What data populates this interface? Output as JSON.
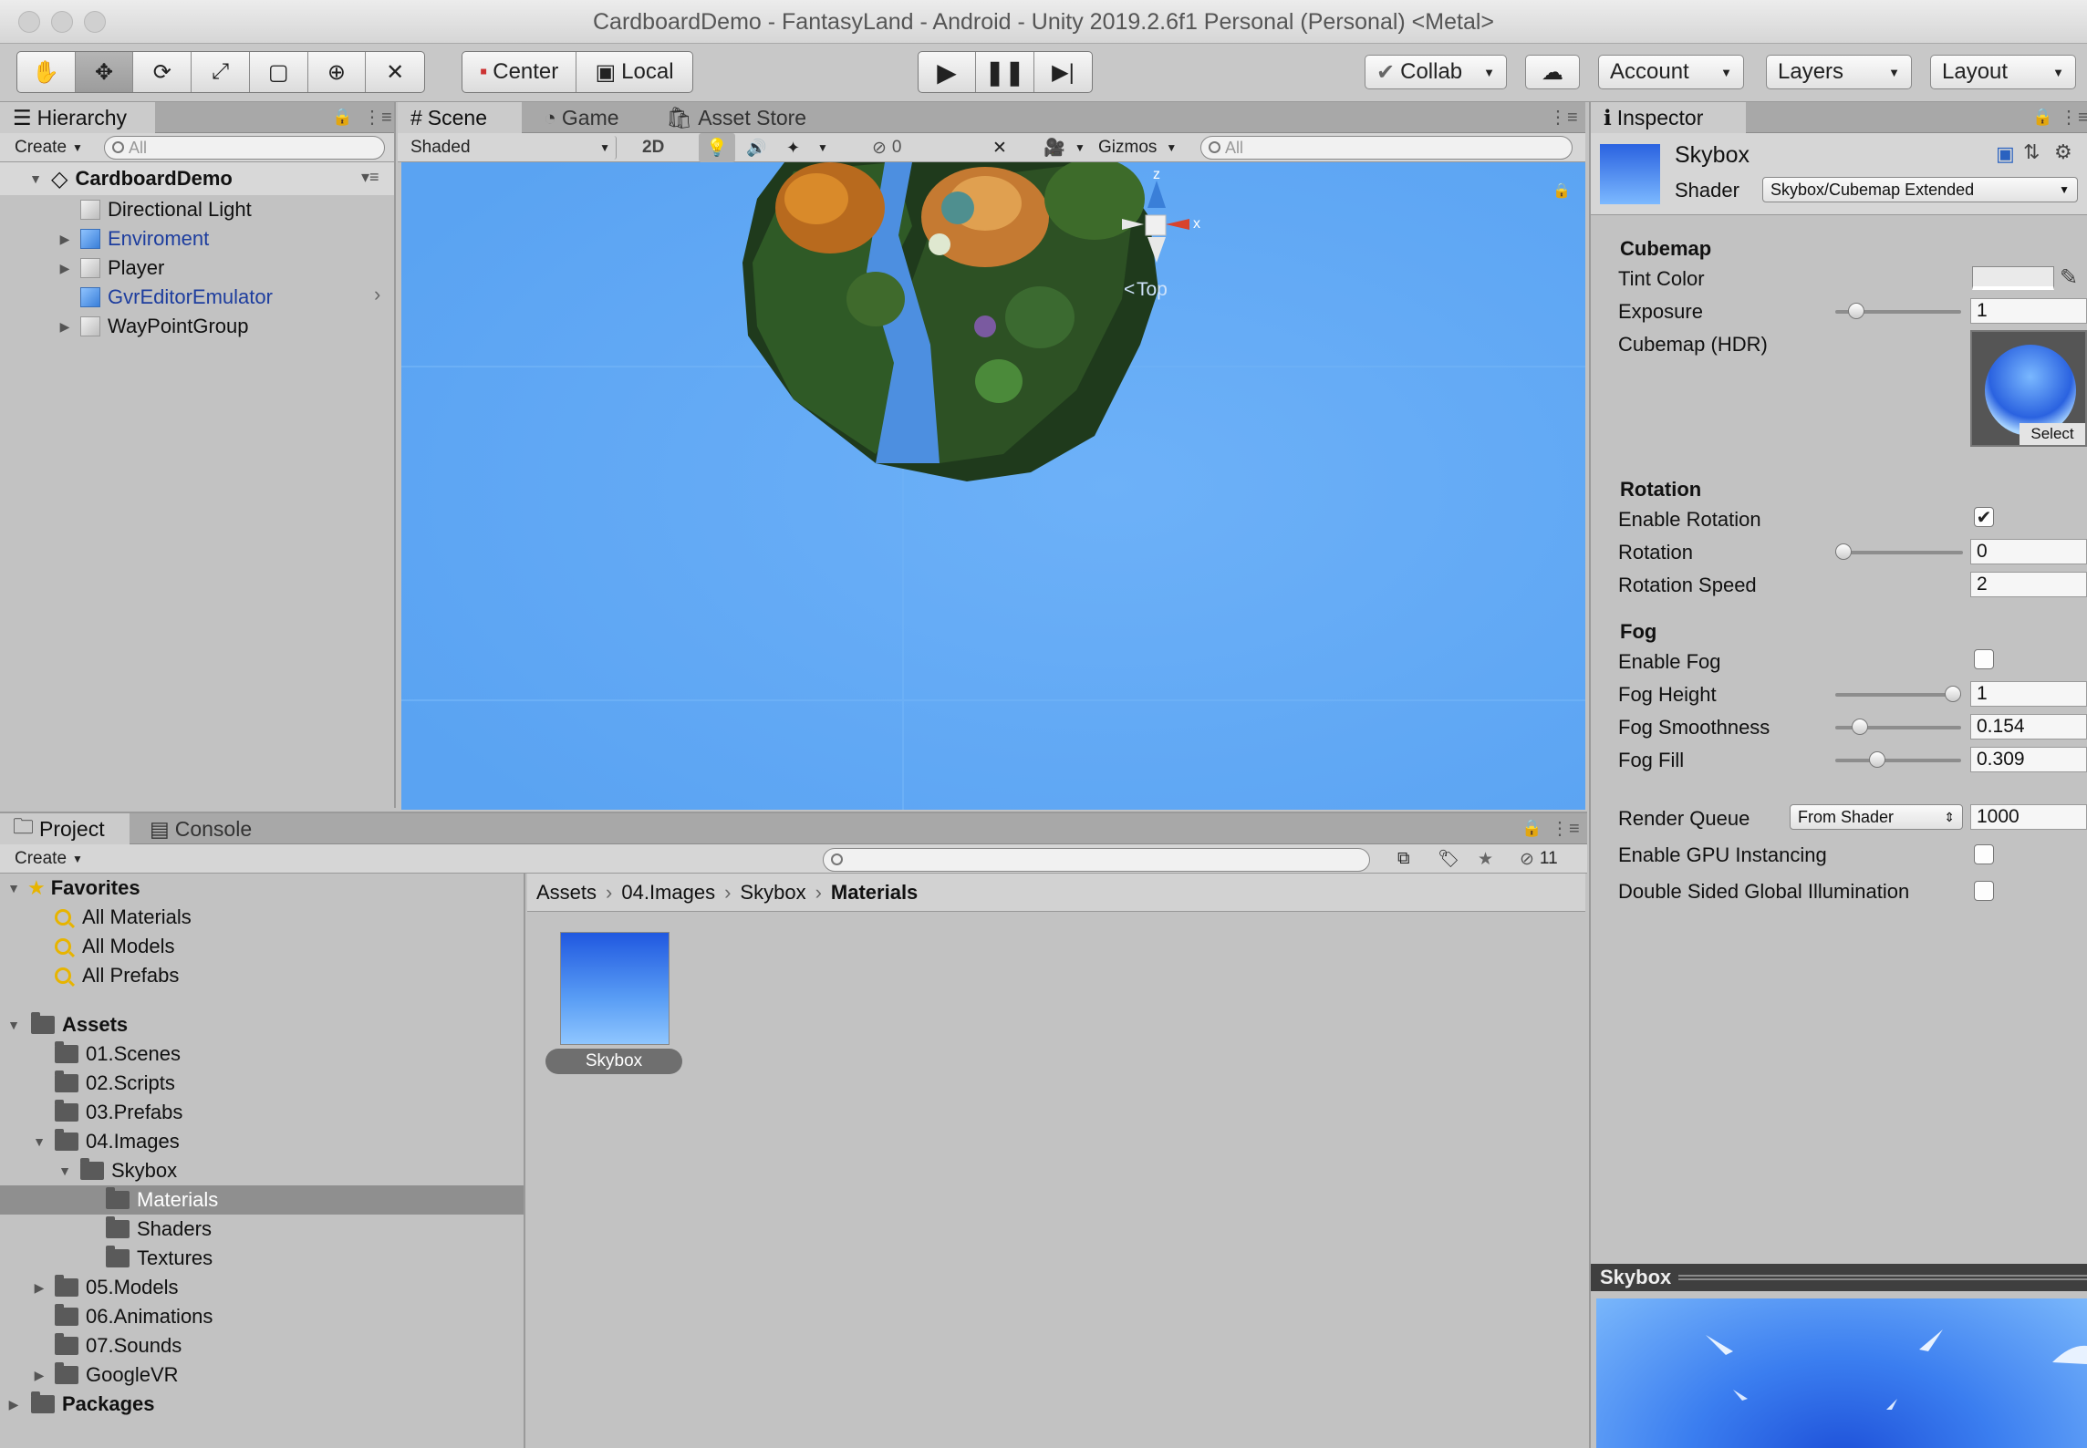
{
  "window": {
    "title": "CardboardDemo - FantasyLand - Android - Unity 2019.2.6f1 Personal (Personal) <Metal>"
  },
  "toolbar": {
    "pivot_mode": "Center",
    "pivot_rotation": "Local",
    "collab": "Collab",
    "account": "Account",
    "layers": "Layers",
    "layout": "Layout"
  },
  "hierarchy": {
    "tab": "Hierarchy",
    "create": "Create",
    "search_placeholder": "All",
    "scene": "CardboardDemo",
    "items": [
      {
        "label": "Directional Light"
      },
      {
        "label": "Enviroment"
      },
      {
        "label": "Player"
      },
      {
        "label": "GvrEditorEmulator"
      },
      {
        "label": "WayPointGroup"
      }
    ]
  },
  "scene_view": {
    "tabs": [
      "Scene",
      "Game",
      "Asset Store"
    ],
    "shading": "Shaded",
    "mode_2d": "2D",
    "hidden_count": "0",
    "gizmos": "Gizmos",
    "search_placeholder": "All",
    "gizmo_z": "z",
    "gizmo_x": "x",
    "view_label": "Top"
  },
  "project": {
    "tabs": [
      "Project",
      "Console"
    ],
    "create": "Create",
    "hidden_count": "11",
    "favorites": {
      "label": "Favorites",
      "items": [
        "All Materials",
        "All Models",
        "All Prefabs"
      ]
    },
    "assets": {
      "label": "Assets",
      "folders": [
        "01.Scenes",
        "02.Scripts",
        "03.Prefabs",
        "04.Images",
        "Skybox",
        "Materials",
        "Shaders",
        "Textures",
        "05.Models",
        "06.Animations",
        "07.Sounds",
        "GoogleVR"
      ]
    },
    "packages": "Packages",
    "breadcrumb": [
      "Assets",
      "04.Images",
      "Skybox",
      "Materials"
    ],
    "asset_name": "Skybox"
  },
  "inspector": {
    "tab": "Inspector",
    "name": "Skybox",
    "shader_label": "Shader",
    "shader_value": "Skybox/Cubemap Extended",
    "sections": {
      "cubemap": "Cubemap",
      "rotation": "Rotation",
      "fog": "Fog"
    },
    "props": {
      "tint_color": "Tint Color",
      "exposure": "Exposure",
      "exposure_value": "1",
      "cubemap_hdr": "Cubemap (HDR)",
      "select": "Select",
      "enable_rotation": "Enable Rotation",
      "rotation": "Rotation",
      "rotation_value": "0",
      "rotation_speed": "Rotation Speed",
      "rotation_speed_value": "2",
      "enable_fog": "Enable Fog",
      "fog_height": "Fog Height",
      "fog_height_value": "1",
      "fog_smoothness": "Fog Smoothness",
      "fog_smoothness_value": "0.154",
      "fog_fill": "Fog Fill",
      "fog_fill_value": "0.309",
      "render_queue": "Render Queue",
      "render_queue_mode": "From Shader",
      "render_queue_value": "1000",
      "gpu_instancing": "Enable GPU Instancing",
      "double_sided_gi": "Double Sided Global Illumination"
    },
    "slider_levels": {
      "exposure": 0.12,
      "rotation": 0.0,
      "fog_height": 1.0,
      "fog_smoothness": 0.154,
      "fog_fill": 0.309
    },
    "checkboxes": {
      "enable_rotation": true,
      "enable_fog": false,
      "gpu_instancing": false,
      "double_sided_gi": false
    },
    "preview_title": "Skybox"
  },
  "colors": {
    "sky": "#5fa8f5",
    "selection": "#8f8f8f",
    "prefab_blue": "#1d3d9e"
  }
}
